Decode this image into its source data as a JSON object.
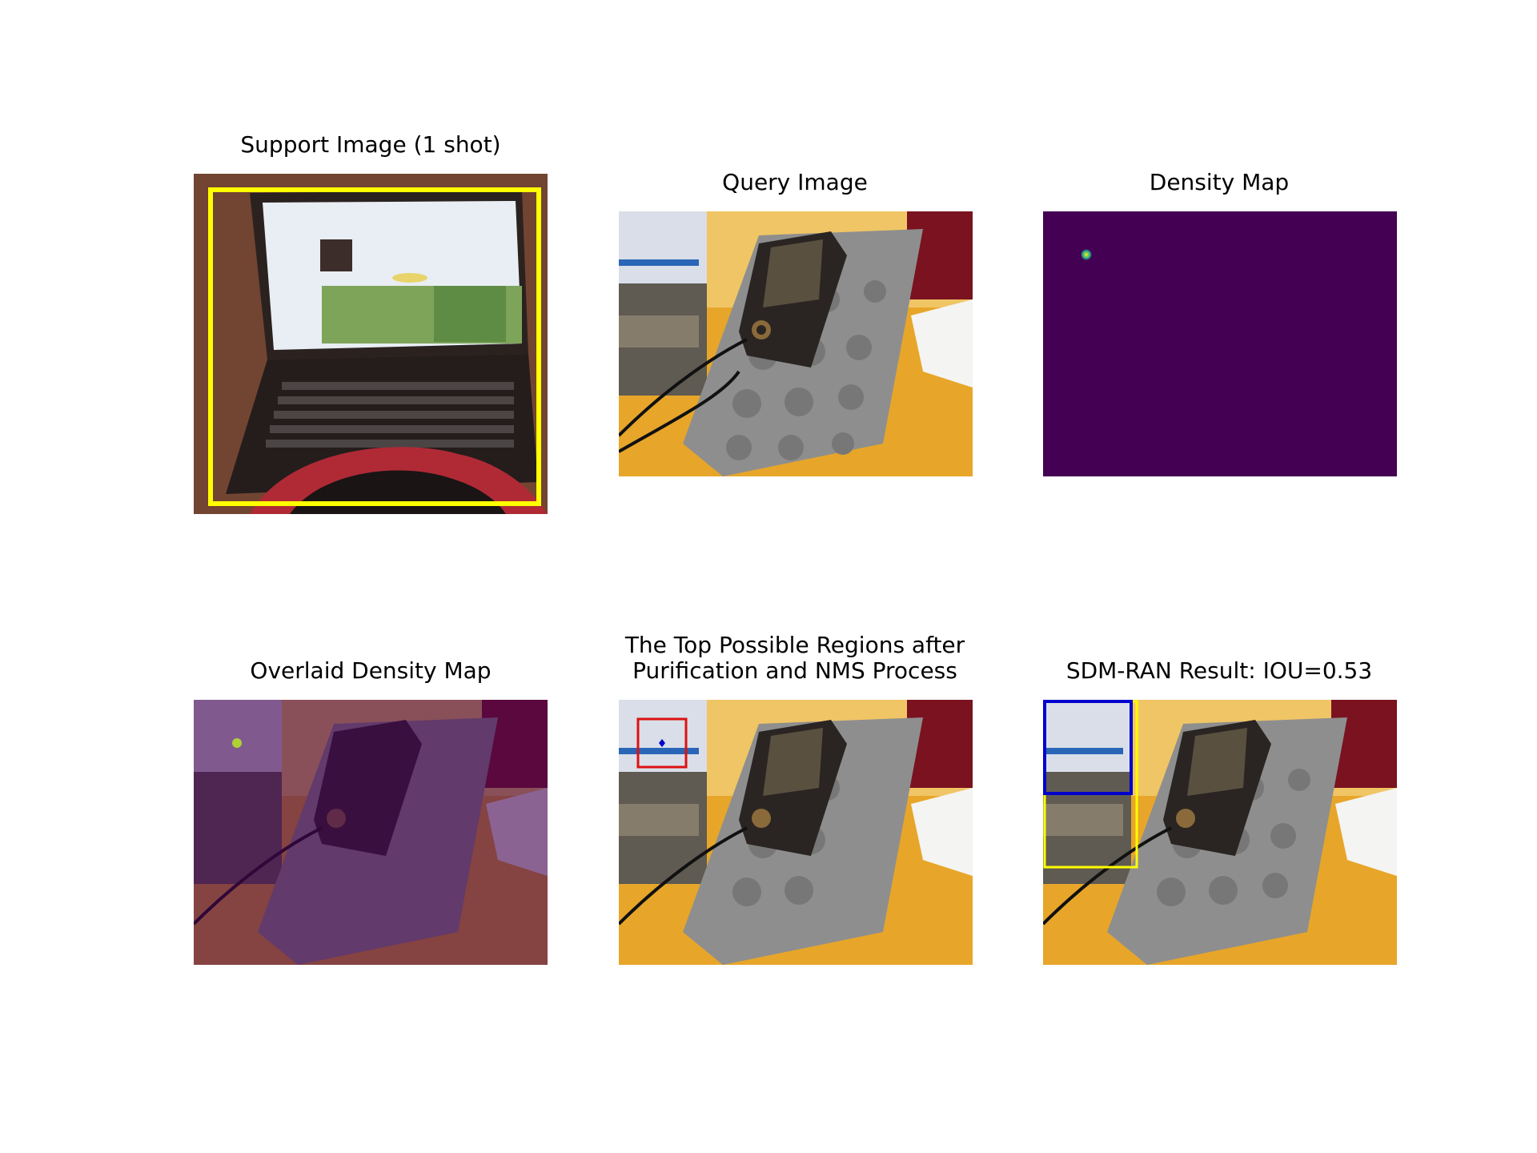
{
  "panels": {
    "support": {
      "title": "Support Image (1 shot)"
    },
    "query": {
      "title": "Query Image"
    },
    "density": {
      "title": "Density Map"
    },
    "overlaid": {
      "title": "Overlaid Density Map"
    },
    "regions": {
      "title_line1": "The Top Possible Regions after",
      "title_line2": "Purification and NMS Process"
    },
    "result": {
      "title": "SDM-RAN Result: IOU=0.53"
    }
  },
  "colors": {
    "support_box": "#ffff00",
    "density_bg": "#440154",
    "density_peak": "#b5de2b",
    "candidate_box": "#dd1111",
    "predicted_box": "#0000cc",
    "ground_truth_box": "#ffff00"
  }
}
